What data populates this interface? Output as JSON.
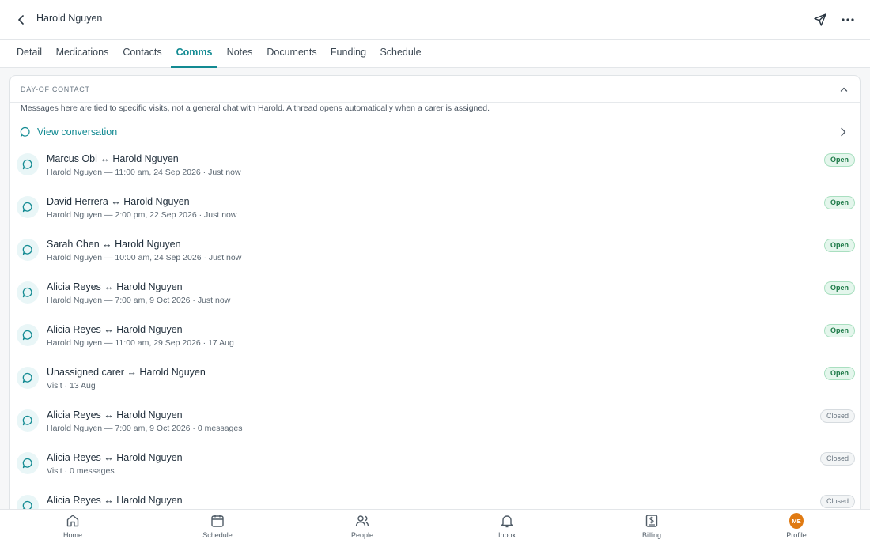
{
  "header": {
    "title": "Harold Nguyen"
  },
  "tabs": [
    {
      "label": "Detail"
    },
    {
      "label": "Medications"
    },
    {
      "label": "Contacts"
    },
    {
      "label": "Comms",
      "active": true
    },
    {
      "label": "Notes"
    },
    {
      "label": "Documents"
    },
    {
      "label": "Funding"
    },
    {
      "label": "Schedule"
    }
  ],
  "section": {
    "title": "DAY-OF CONTACT",
    "note": "Messages here are tied to specific visits, not a general chat with Harold. A thread opens automatically when a carer is assigned.",
    "view_conversation": "View conversation"
  },
  "threads": [
    {
      "title": "Marcus Obi ↔ Harold Nguyen",
      "subtitle": "Harold Nguyen — 11:00 am, 24 Sep 2026 · Just now",
      "status": "Open"
    },
    {
      "title": "David Herrera ↔ Harold Nguyen",
      "subtitle": "Harold Nguyen — 2:00 pm, 22 Sep 2026 · Just now",
      "status": "Open"
    },
    {
      "title": "Sarah Chen ↔ Harold Nguyen",
      "subtitle": "Harold Nguyen — 10:00 am, 24 Sep 2026 · Just now",
      "status": "Open"
    },
    {
      "title": "Alicia Reyes ↔ Harold Nguyen",
      "subtitle": "Harold Nguyen — 7:00 am, 9 Oct 2026 · Just now",
      "status": "Open"
    },
    {
      "title": "Alicia Reyes ↔ Harold Nguyen",
      "subtitle": "Harold Nguyen — 11:00 am, 29 Sep 2026 · 17 Aug",
      "status": "Open"
    },
    {
      "title": "Unassigned carer ↔ Harold Nguyen",
      "subtitle": "Visit · 13 Aug",
      "status": "Open"
    },
    {
      "title": "Alicia Reyes ↔ Harold Nguyen",
      "subtitle": "Harold Nguyen — 7:00 am, 9 Oct 2026 · 0 messages",
      "status": "Closed"
    },
    {
      "title": "Alicia Reyes ↔ Harold Nguyen",
      "subtitle": "Visit · 0 messages",
      "status": "Closed"
    },
    {
      "title": "Alicia Reyes ↔ Harold Nguyen",
      "subtitle": "",
      "status": "Closed"
    }
  ],
  "bottom_nav": [
    {
      "label": "Home",
      "icon": "home-icon"
    },
    {
      "label": "Schedule",
      "icon": "calendar-icon"
    },
    {
      "label": "People",
      "icon": "people-icon"
    },
    {
      "label": "Inbox",
      "icon": "bell-icon"
    },
    {
      "label": "Billing",
      "icon": "billing-icon"
    },
    {
      "label": "Profile",
      "icon": "avatar",
      "initials": "ME"
    }
  ],
  "colors": {
    "accent": "#128a92",
    "open_badge": "#1e7a48",
    "avatar": "#e07a12"
  }
}
